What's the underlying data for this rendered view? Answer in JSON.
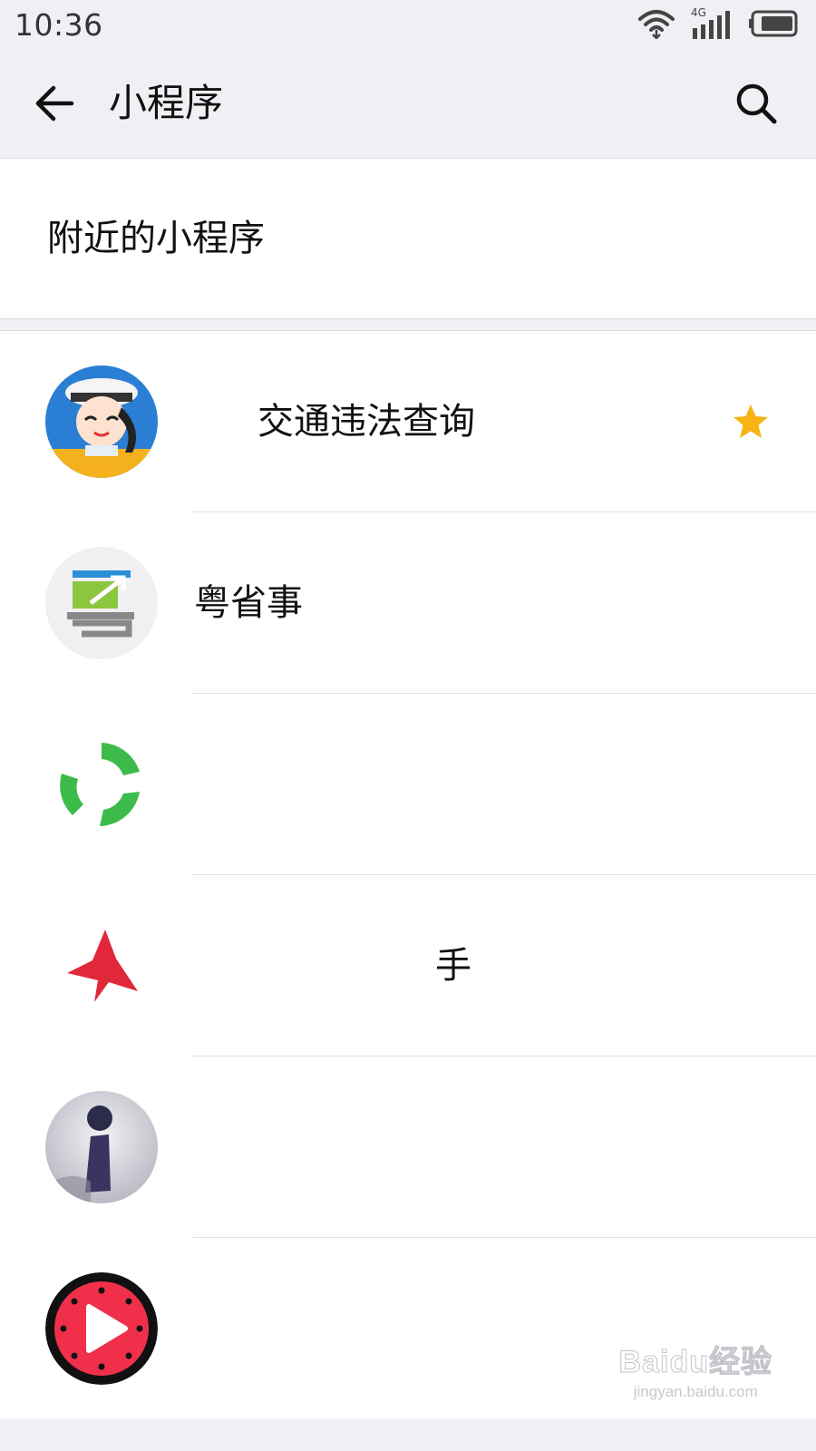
{
  "status_bar": {
    "time": "10:36",
    "network": "4G",
    "icons": [
      "wifi-icon",
      "signal-icon",
      "battery-icon"
    ]
  },
  "header": {
    "title": "小程序",
    "back_icon": "arrow-left-icon",
    "search_icon": "search-icon"
  },
  "nearby": {
    "label": "附近的小程序"
  },
  "list": {
    "items": [
      {
        "name": "交通违法查询",
        "icon": "traffic-police-cartoon-icon",
        "starred": true
      },
      {
        "name": "粤省事",
        "icon": "yue-sheng-shi-logo-icon",
        "starred": false
      },
      {
        "name": "",
        "icon": "green-recycle-arrows-icon",
        "starred": false
      },
      {
        "name": "手",
        "icon": "red-fox-logo-icon",
        "starred": false
      },
      {
        "name": "",
        "icon": "info-person-icon",
        "starred": false
      },
      {
        "name": "",
        "icon": "watermelon-play-icon",
        "starred": false
      }
    ]
  },
  "colors": {
    "header_bg": "#efeff4",
    "star": "#f6b514",
    "icon_green": "#3dbb4a",
    "icon_red": "#e0283a"
  },
  "watermark": {
    "main": "Baidu经验",
    "sub": "jingyan.baidu.com"
  }
}
